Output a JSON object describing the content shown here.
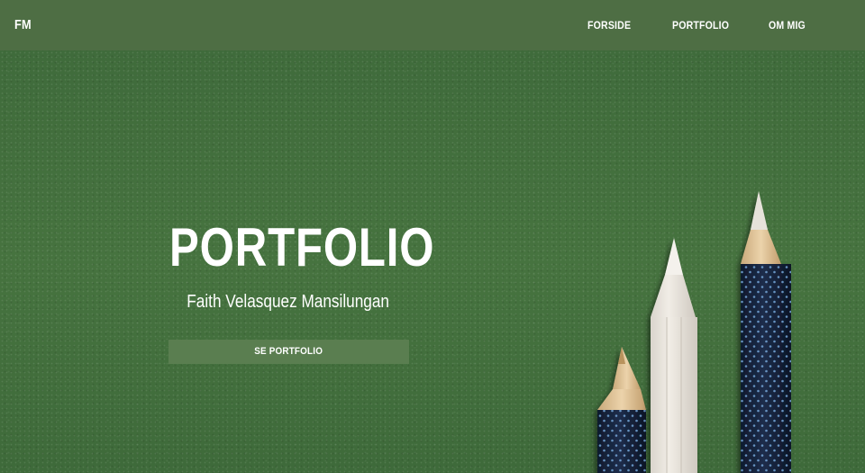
{
  "header": {
    "logo": "FM",
    "nav": [
      {
        "label": "FORSIDE"
      },
      {
        "label": "PORTFOLIO"
      },
      {
        "label": "OM MIG"
      }
    ]
  },
  "hero": {
    "title": "PORTFOLIO",
    "subtitle": "Faith Velasquez Mansilungan",
    "button_label": "SE PORTFOLIO"
  },
  "colors": {
    "header_bg": "#4e6e44",
    "hero_bg": "#43703f",
    "button_bg": "#5a7e50",
    "text": "#ffffff"
  },
  "icons": [
    "pencils-illustration"
  ]
}
